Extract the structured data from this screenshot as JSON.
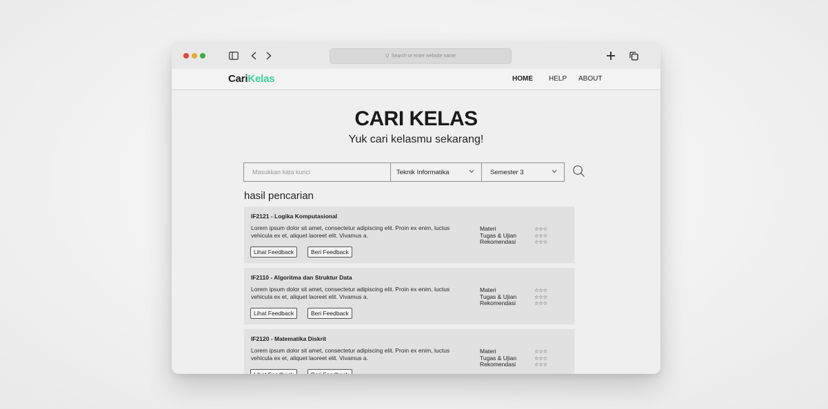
{
  "browser": {
    "address_placeholder": "Search or enter website name"
  },
  "site": {
    "logo_part1": "Cari",
    "logo_part2": "Kelas",
    "nav": [
      {
        "label": "HOME",
        "active": true
      },
      {
        "label": "HELP",
        "active": false
      },
      {
        "label": "ABOUT",
        "active": false
      }
    ]
  },
  "hero": {
    "title": "CARI KELAS",
    "subtitle": "Yuk cari kelasmu sekarang!"
  },
  "search": {
    "keyword_placeholder": "Masukkan kata kunci",
    "jurusan_selected": "Teknik Informatika",
    "semester_selected": "Semester 3"
  },
  "results": {
    "title": "hasil pencarian",
    "rating_labels": [
      "Materi",
      "Tugas & Ujian",
      "Rekomendasi"
    ],
    "stars": "☆☆☆",
    "lihat_label": "Lihat Feedback",
    "beri_label": "Beri Feedback",
    "items": [
      {
        "title": "IF2121 - Logika Komputasional",
        "desc": "Lorem ipsum dolor sit amet, consectetur adipiscing elit. Proin ex enim, luctus vehicula ex et, aliquet laoreet elit. Vivamus a."
      },
      {
        "title": "IF2110 - Algoritma dan Struktur Data",
        "desc": "Lorem ipsum dolor sit amet, consectetur adipiscing elit. Proin ex enim, luctus vehicula ex et, aliquet laoreet elit. Vivamus a."
      },
      {
        "title": "IF2120 - Matematika Diskrit",
        "desc": "Lorem ipsum dolor sit amet, consectetur adipiscing elit. Proin ex enim, luctus vehicula ex et, aliquet laoreet elit. Vivamus a."
      }
    ]
  },
  "colors": {
    "brand_green": "#3ccf9e",
    "traffic_red": "#e8433a",
    "traffic_yellow": "#e7a72c",
    "traffic_green": "#3cae3f"
  },
  "icons": [
    "sidebar-icon",
    "chevron-left-icon",
    "chevron-right-icon",
    "search-icon",
    "plus-icon",
    "tabs-icon",
    "chevron-down-icon",
    "star-outline-icon"
  ]
}
